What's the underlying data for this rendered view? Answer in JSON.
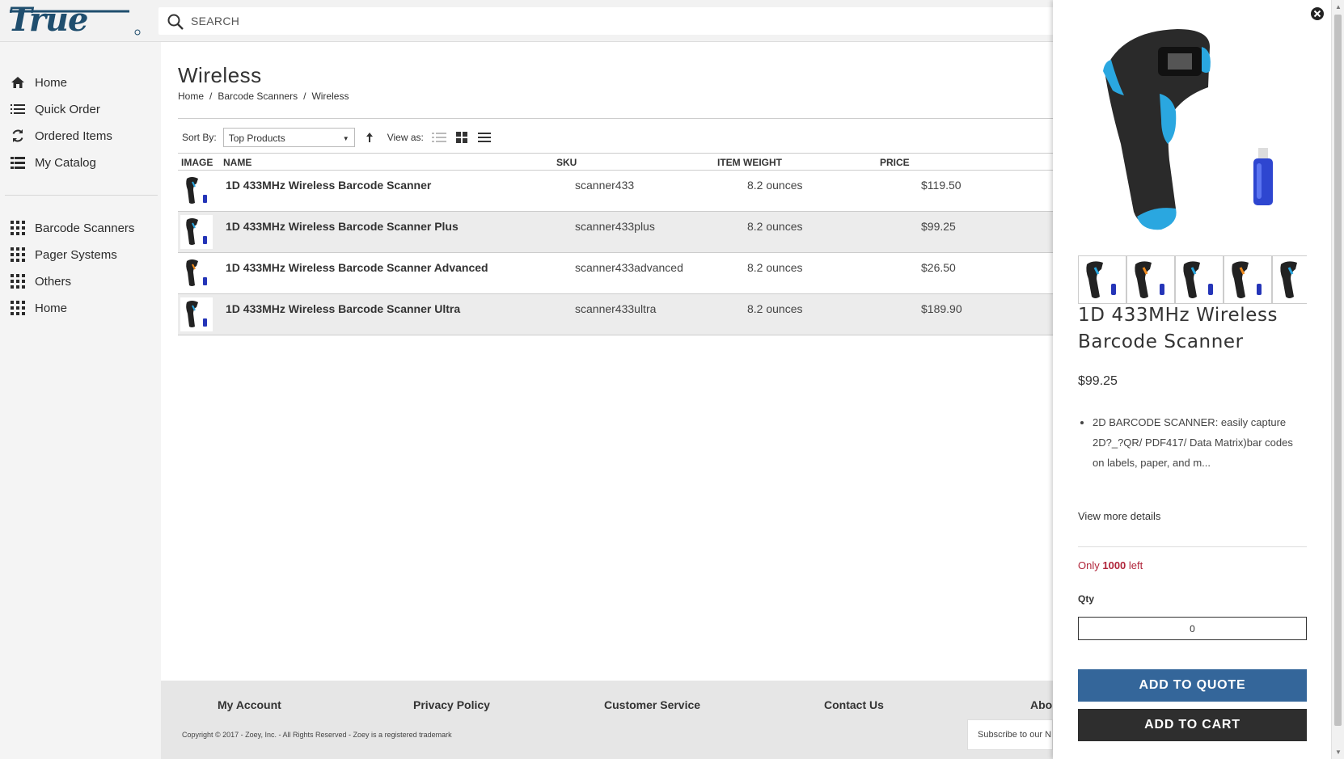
{
  "header": {
    "logo_text": "True",
    "search_placeholder": "SEARCH"
  },
  "sidebar": {
    "primary": [
      {
        "label": "Home",
        "icon": "home-icon"
      },
      {
        "label": "Quick Order",
        "icon": "list-icon"
      },
      {
        "label": "Ordered Items",
        "icon": "refresh-icon"
      },
      {
        "label": "My Catalog",
        "icon": "catalog-icon"
      }
    ],
    "categories": [
      {
        "label": "Barcode Scanners",
        "icon": "grid-icon"
      },
      {
        "label": "Pager Systems",
        "icon": "grid-icon"
      },
      {
        "label": "Others",
        "icon": "grid-icon"
      },
      {
        "label": "Home",
        "icon": "grid-icon"
      }
    ]
  },
  "main": {
    "title": "Wireless",
    "breadcrumb": [
      "Home",
      "Barcode Scanners",
      "Wireless"
    ],
    "breadcrumb_sep": "/",
    "toolbar": {
      "sort_label": "Sort By:",
      "sort_value": "Top Products",
      "view_label": "View as:"
    },
    "table": {
      "headers": [
        "IMAGE",
        "NAME",
        "SKU",
        "ITEM WEIGHT",
        "PRICE"
      ],
      "rows": [
        {
          "name": "1D 433MHz Wireless Barcode Scanner",
          "sku": "scanner433",
          "weight": "8.2 ounces",
          "price": "$119.50"
        },
        {
          "name": "1D 433MHz Wireless Barcode Scanner Plus",
          "sku": "scanner433plus",
          "weight": "8.2 ounces",
          "price": "$99.25"
        },
        {
          "name": "1D 433MHz Wireless Barcode Scanner Advanced",
          "sku": "scanner433advanced",
          "weight": "8.2 ounces",
          "price": "$26.50"
        },
        {
          "name": "1D 433MHz Wireless Barcode Scanner Ultra",
          "sku": "scanner433ultra",
          "weight": "8.2 ounces",
          "price": "$189.90"
        }
      ]
    }
  },
  "footer": {
    "links": [
      "My Account",
      "Privacy Policy",
      "Customer Service",
      "Contact Us",
      "Abou"
    ],
    "copyright": "Copyright © 2017 - Zoey, Inc. - All Rights Reserved - Zoey is a registered trademark",
    "subscribe_placeholder": "Subscribe to our N"
  },
  "quickview": {
    "title": "1D 433MHz Wireless Barcode Scanner",
    "price": "$99.25",
    "description": "2D BARCODE SCANNER: easily capture 2D?_?QR/ PDF417/ Data Matrix)bar codes on labels, paper, and m...",
    "view_more": "View more details",
    "stock_prefix": "Only",
    "stock_count": "1000",
    "stock_suffix": "left",
    "qty_label": "Qty",
    "qty_value": "0",
    "add_to_quote": "ADD TO QUOTE",
    "add_to_cart": "ADD TO CART"
  },
  "colors": {
    "brand_blue": "#1f4e6e",
    "quote_button": "#34669a",
    "cart_button": "#2e2e2e",
    "stock_red": "#b0253a",
    "scanner_accent": "#2aa7e0"
  }
}
